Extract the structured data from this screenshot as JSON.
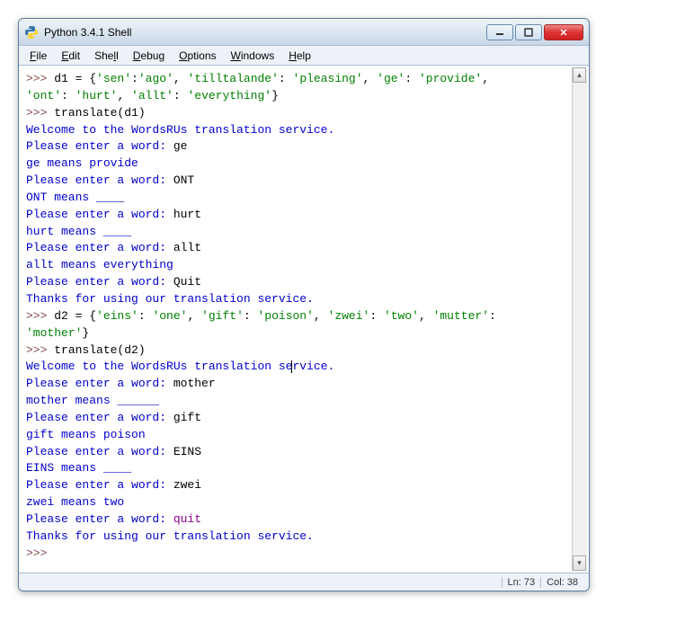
{
  "title": "Python 3.4.1 Shell",
  "menu": {
    "file": "File",
    "edit": "Edit",
    "shell": "Shell",
    "debug": "Debug",
    "options": "Options",
    "windows": "Windows",
    "help": "Help"
  },
  "prompt": ">>> ",
  "lines": {
    "d1_assign_head": "d1 = {",
    "d1_k_sen": "'sen'",
    "d1_c1": ":",
    "d1_v_ago": "'ago'",
    "d1_s1": ", ",
    "d1_k_till": "'tilltalande'",
    "d1_c2": ": ",
    "d1_v_plea": "'pleasing'",
    "d1_s2": ", ",
    "d1_k_ge": "'ge'",
    "d1_c3": ": ",
    "d1_v_prov": "'provide'",
    "d1_s3": ",",
    "d1_k_ont": "'ont'",
    "d1_c4": ": ",
    "d1_v_hurt": "'hurt'",
    "d1_s4": ", ",
    "d1_k_allt": "'allt'",
    "d1_c5": ": ",
    "d1_v_ev": "'everything'",
    "d1_close": "}",
    "call1": "translate(d1)",
    "welcome": "Welcome to the WordsRUs translation service.",
    "enter_word": "Please enter a word: ",
    "in_ge": "ge",
    "out_ge": "ge means provide",
    "in_ONT": "ONT",
    "out_ONT": "ONT means ____",
    "in_hurt": "hurt",
    "out_hurt": "hurt means ____",
    "in_allt": "allt",
    "out_allt": "allt means everything",
    "in_Quit": "Quit",
    "thanks": "Thanks for using our translation service.",
    "d2_assign_head": "d2 = {",
    "d2_k_eins": "'eins'",
    "d2_c1": ": ",
    "d2_v_one": "'one'",
    "d2_s1": ", ",
    "d2_k_gift": "'gift'",
    "d2_c2": ": ",
    "d2_v_poi": "'poison'",
    "d2_s2": ", ",
    "d2_k_zwei": "'zwei'",
    "d2_c3": ": ",
    "d2_v_two": "'two'",
    "d2_s3": ", ",
    "d2_k_mut": "'mutter'",
    "d2_c4": ":",
    "d2_v_mot": "'mother'",
    "d2_close": "}",
    "call2": "translate(d2)",
    "welcome2a": "Welcome to the WordsRUs translation se",
    "welcome2b": "rvice.",
    "in_mother": "mother",
    "out_mother": "mother means ______",
    "in_gift": "gift",
    "out_gift": "gift means poison",
    "in_EINS": "EINS",
    "out_EINS": "EINS means ____",
    "in_zwei": "zwei",
    "out_zwei": "zwei means two",
    "in_quit": "quit"
  },
  "status": {
    "ln": "Ln: 73",
    "col": "Col: 38"
  }
}
